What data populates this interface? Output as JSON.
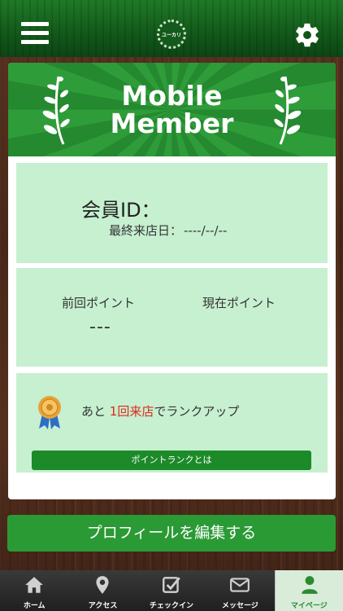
{
  "header": {
    "menu_icon": "hamburger-menu-icon",
    "logo_text": "ユーカリ",
    "settings_icon": "gear-icon"
  },
  "banner": {
    "title_line1": "Mobile",
    "title_line2": "Member"
  },
  "member": {
    "id_label": "会員ID：",
    "last_visit_label": "最終来店日：",
    "last_visit_value": "----/--/--"
  },
  "points": {
    "prev_label": "前回ポイント",
    "current_label": "現在ポイント",
    "prev_value": "---"
  },
  "rank": {
    "text_prefix": "あと ",
    "text_highlight": "1回来店",
    "text_suffix": "でランクアップ",
    "button_label": "ポイントランクとは"
  },
  "edit_profile_label": "プロフィールを編集する",
  "tabs": [
    {
      "label": "ホーム",
      "icon": "home-icon"
    },
    {
      "label": "アクセス",
      "icon": "map-pin-icon"
    },
    {
      "label": "チェックイン",
      "icon": "checkin-icon"
    },
    {
      "label": "メッセージ",
      "icon": "envelope-icon"
    },
    {
      "label": "マイページ",
      "icon": "user-icon"
    }
  ],
  "colors": {
    "header_green": "#1f7a27",
    "panel_green": "#c6f0d0",
    "button_green": "#2a9a35",
    "highlight_red": "#e0271b"
  }
}
